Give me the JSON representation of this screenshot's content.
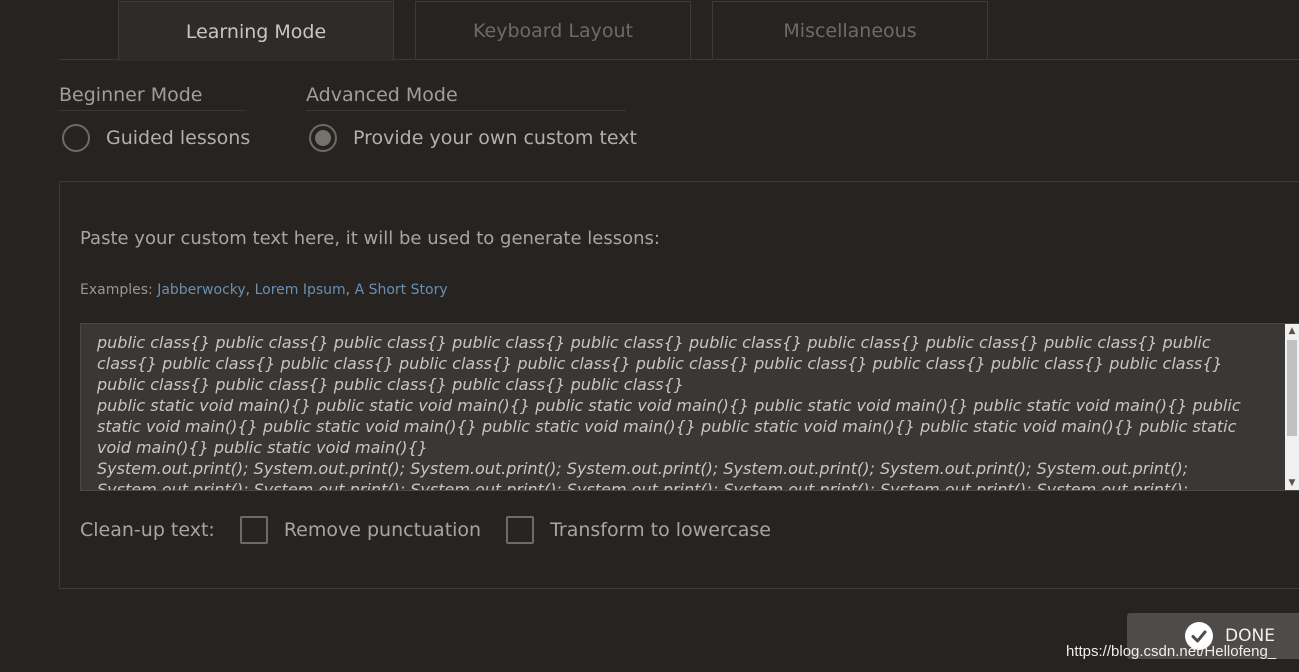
{
  "tabs": [
    {
      "label": "Learning Mode",
      "active": true
    },
    {
      "label": "Keyboard Layout",
      "active": false
    },
    {
      "label": "Miscellaneous",
      "active": false
    }
  ],
  "modes": {
    "beginner": {
      "heading": "Beginner Mode",
      "option_label": "Guided lessons",
      "selected": false
    },
    "advanced": {
      "heading": "Advanced Mode",
      "option_label": "Provide your own custom text",
      "selected": true
    }
  },
  "custom_text": {
    "instructions": "Paste your custom text here, it will be used to generate lessons:",
    "examples_prefix": "Examples: ",
    "examples": [
      "Jabberwocky",
      "Lorem Ipsum",
      "A Short Story"
    ],
    "separator": ", ",
    "textarea_value": "public class{} public class{} public class{} public class{} public class{} public class{} public class{} public class{} public class{} public class{} public class{} public class{} public class{} public class{} public class{} public class{} public class{} public class{} public class{} public class{} public class{} public class{} public class{} public class{}\npublic static void main(){} public static void main(){} public static void main(){} public static void main(){} public static void main(){} public static void main(){} public static void main(){} public static void main(){} public static void main(){} public static void main(){} public static void main(){} public static void main(){}\nSystem.out.print(); System.out.print(); System.out.print(); System.out.print(); System.out.print(); System.out.print(); System.out.print(); System.out.print(); System.out.print(); System.out.print(); System.out.print(); System.out.print(); System.out.print(); System.out.print(); System.out.print(); System.out.print();"
  },
  "cleanup": {
    "label": "Clean-up text:",
    "remove_punctuation": {
      "label": "Remove punctuation",
      "checked": false
    },
    "lowercase": {
      "label": "Transform to lowercase",
      "checked": false
    }
  },
  "done_button": {
    "label": "DONE",
    "icon": "check-circle-icon"
  },
  "watermark": "https://blog.csdn.net/Hellofeng_",
  "colors": {
    "background": "#262321",
    "link": "#6a8fb2",
    "button": "#4e4b48"
  }
}
